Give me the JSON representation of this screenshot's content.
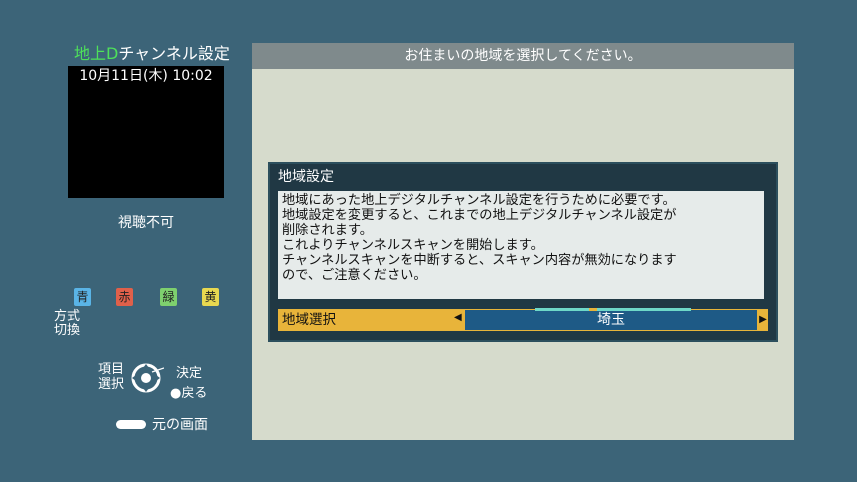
{
  "left_panel": {
    "title_green": "地上D",
    "title_rest": "チャンネル設定",
    "datetime": "10月11日(木) 10:02",
    "no_video": "視聴不可",
    "color_buttons": {
      "blue": "青",
      "red": "赤",
      "green": "緑",
      "yellow": "黄"
    },
    "method_switch_line1": "方式",
    "method_switch_line2": "切換",
    "item_select_line1": "項目",
    "item_select_line2": "選択",
    "decide": "決定",
    "back": "●戻る",
    "previous_screen": "元の画面"
  },
  "main": {
    "header": "お住まいの地域を選択してください。",
    "dialog": {
      "title": "地域設定",
      "lines": [
        "地域にあった地上デジタルチャンネル設定を行うために必要です。",
        "地域設定を変更すると、これまでの地上デジタルチャンネル設定が",
        "削除されます。",
        "これよりチャンネルスキャンを開始します。",
        "チャンネルスキャンを中断すると、スキャン内容が無効になります",
        "ので、ご注意ください。"
      ],
      "region_label": "地域選択",
      "region_value": "埼玉"
    }
  }
}
